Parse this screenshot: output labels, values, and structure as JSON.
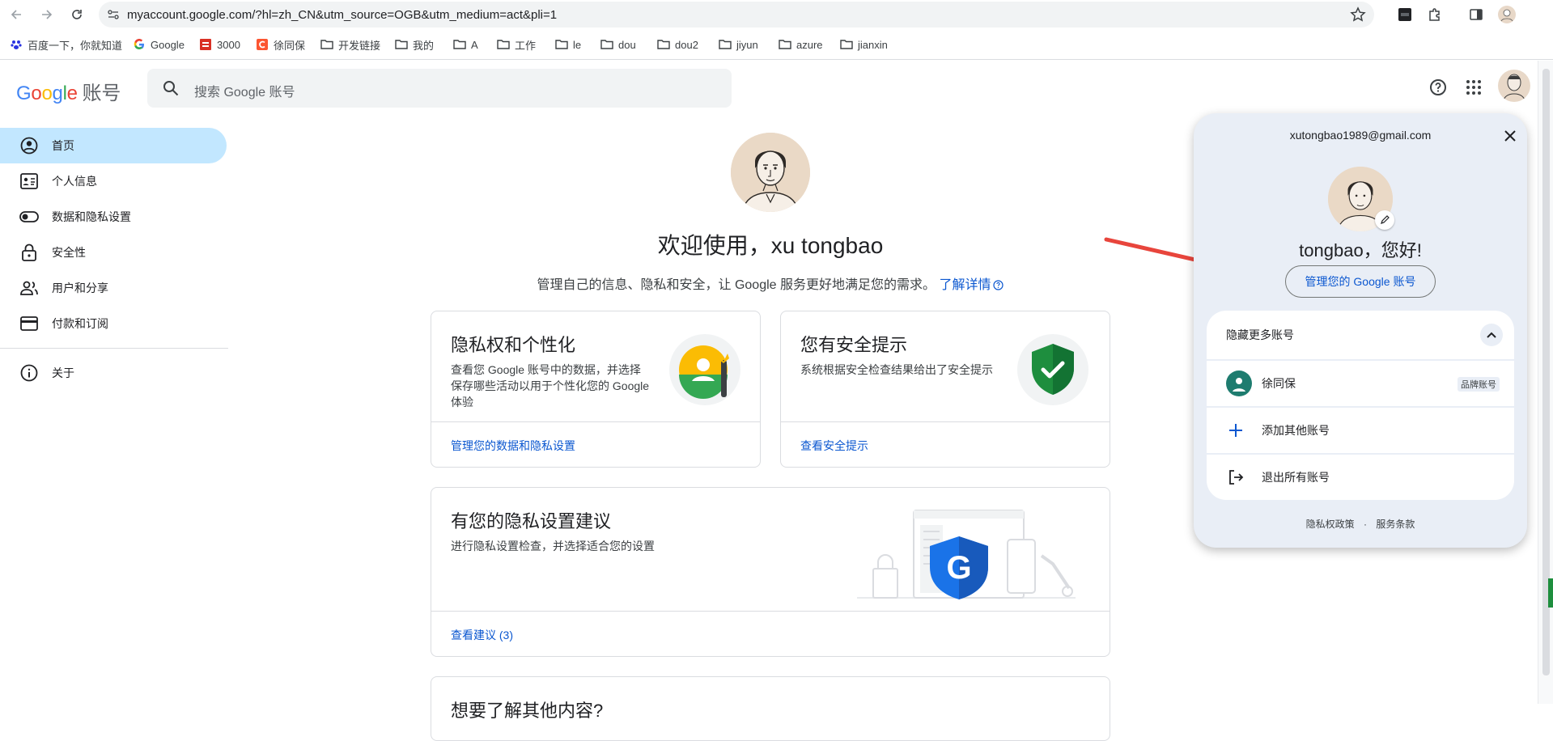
{
  "browser": {
    "url": "myaccount.google.com/?hl=zh_CN&utm_source=OGB&utm_medium=act&pli=1",
    "bookmarks": [
      "百度一下，你就知道",
      "Google",
      "3000",
      "徐同保",
      "开发链接",
      "我的",
      "A",
      "工作",
      "le",
      "dou",
      "dou2",
      "jiyun",
      "azure",
      "jianxin"
    ]
  },
  "header": {
    "logo_google": [
      "G",
      "o",
      "o",
      "g",
      "l",
      "e"
    ],
    "logo_suffix": "账号",
    "search_placeholder": "搜索 Google 账号"
  },
  "sidebar": {
    "items": [
      {
        "label": "首页",
        "icon": "account-circle-icon",
        "active": true
      },
      {
        "label": "个人信息",
        "icon": "badge-icon"
      },
      {
        "label": "数据和隐私设置",
        "icon": "toggle-icon"
      },
      {
        "label": "安全性",
        "icon": "lock-icon"
      },
      {
        "label": "用户和分享",
        "icon": "people-icon"
      },
      {
        "label": "付款和订阅",
        "icon": "credit-card-icon"
      }
    ],
    "about": {
      "label": "关于",
      "icon": "info-icon"
    }
  },
  "main": {
    "welcome": "欢迎使用，xu tongbao",
    "subtitle": "管理自己的信息、隐私和安全，让 Google 服务更好地满足您的需求。",
    "learn_more": "了解详情",
    "cards": {
      "privacy": {
        "title": "隐私权和个性化",
        "desc_line1": "查看您 Google 账号中的数据，并选择",
        "desc_line2": "保存哪些活动以用于个性化您的 Google",
        "desc_line3": "体验",
        "link": "管理您的数据和隐私设置"
      },
      "security": {
        "title": "您有安全提示",
        "desc": "系统根据安全检查结果给出了安全提示",
        "link": "查看安全提示"
      },
      "suggestions": {
        "title": "有您的隐私设置建议",
        "desc": "进行隐私设置检查，并选择适合您的设置",
        "link": "查看建议 (3)"
      },
      "more": {
        "title": "想要了解其他内容?"
      }
    }
  },
  "popup": {
    "email": "xutongbao1989@gmail.com",
    "greeting": "tongbao，您好!",
    "manage_button": "管理您的 Google 账号",
    "hide_accounts": "隐藏更多账号",
    "account_name": "徐同保",
    "brand_badge": "品牌账号",
    "add_account": "添加其他账号",
    "sign_out_all": "退出所有账号",
    "privacy_policy": "隐私权政策",
    "dot": "·",
    "terms": "服务条款"
  },
  "colors": {
    "accent_blue": "#0b57d0",
    "active_nav": "#c2e7ff",
    "popup_bg": "#e9eef6",
    "arrow_red": "#e8453c",
    "security_green": "#1e8e3e"
  }
}
